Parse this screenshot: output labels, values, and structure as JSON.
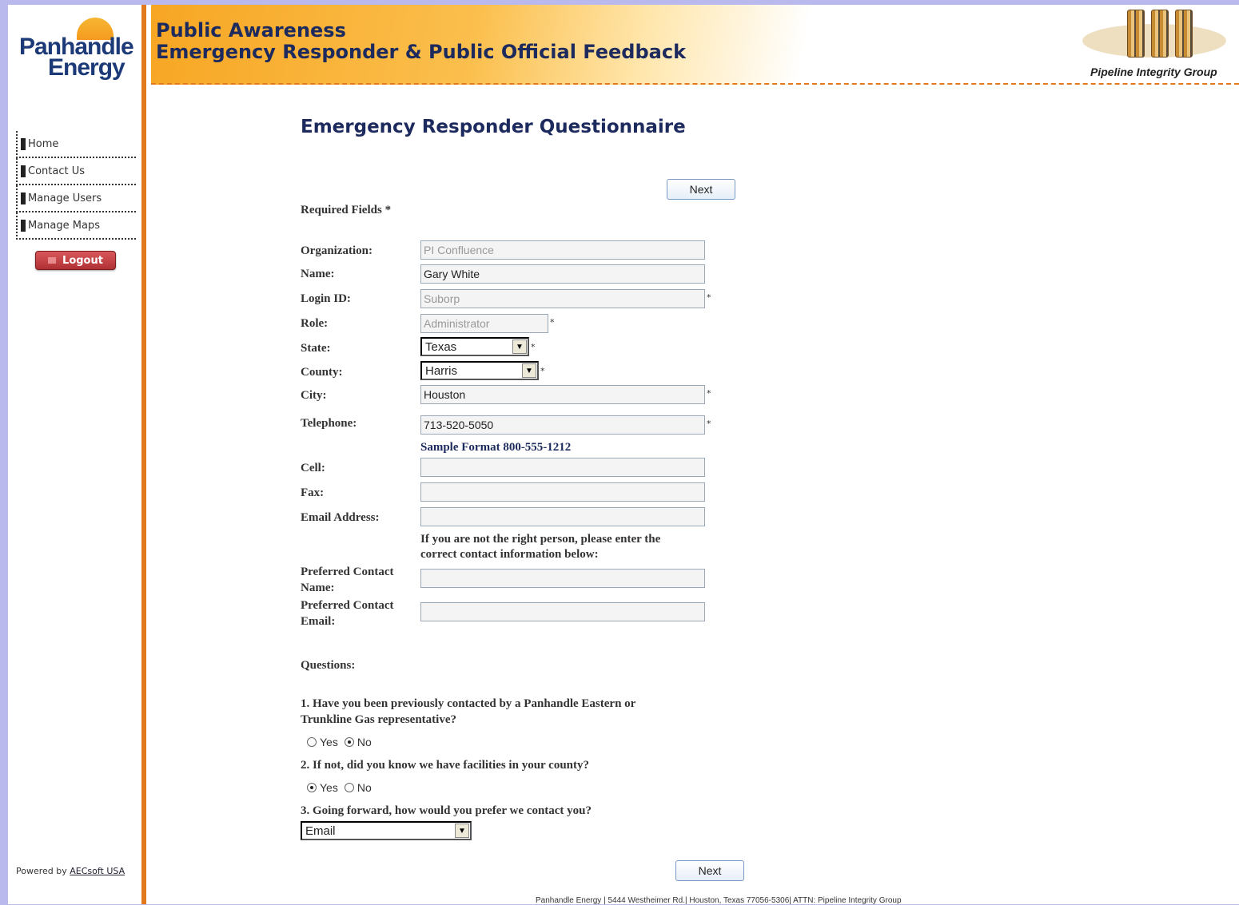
{
  "brand": {
    "line1": "Panhandle",
    "line2": "Energy"
  },
  "nav": {
    "items": [
      "Home",
      "Contact Us",
      "Manage Users",
      "Manage Maps"
    ],
    "logout": "Logout"
  },
  "powered": {
    "prefix": "Powered by ",
    "link": "AECsoft USA"
  },
  "header": {
    "title1": "Public Awareness",
    "title2": "Emergency Responder & Public Official Feedback",
    "partner": "Pipeline Integrity Group"
  },
  "page": {
    "title": "Emergency Responder Questionnaire",
    "next": "Next",
    "required": "Required Fields *"
  },
  "form": {
    "organization": {
      "label": "Organization:",
      "value": "PI Confluence"
    },
    "name": {
      "label": "Name:",
      "value": "Gary White"
    },
    "login": {
      "label": "Login ID:",
      "value": "Suborp"
    },
    "role": {
      "label": "Role:",
      "value": "Administrator"
    },
    "state": {
      "label": "State:",
      "value": "Texas"
    },
    "county": {
      "label": "County:",
      "value": "Harris"
    },
    "city": {
      "label": "City:",
      "value": "Houston"
    },
    "telephone": {
      "label": "Telephone:",
      "value": "713-520-5050",
      "hint": "Sample Format 800-555-1212"
    },
    "cell": {
      "label": "Cell:",
      "value": ""
    },
    "fax": {
      "label": "Fax:",
      "value": ""
    },
    "email": {
      "label": "Email Address:",
      "value": ""
    },
    "note1": "If you are not the right person, please enter the",
    "note2": "correct contact information below:",
    "pref_name": {
      "label1": "Preferred Contact",
      "label2": "Name:",
      "value": ""
    },
    "pref_email": {
      "label1": "Preferred Contact",
      "label2": "Email:",
      "value": ""
    },
    "req_mark": "*"
  },
  "questions": {
    "heading": "Questions:",
    "q1": {
      "line1": "1. Have you been previously contacted by a Panhandle Eastern or",
      "line2": "Trunkline Gas representative?",
      "yes": "Yes",
      "no": "No",
      "selected": "No"
    },
    "q2": {
      "text": "2. If not, did you know we have facilities in your county?",
      "yes": "Yes",
      "no": "No",
      "selected": "Yes"
    },
    "q3": {
      "text": "3. Going forward, how would you prefer we contact you?",
      "value": "Email"
    }
  },
  "footer": "Panhandle Energy  |  5444 Westheimer Rd.|  Houston, Texas 77056-5306|  ATTN: Pipeline Integrity Group",
  "colors": {
    "accent": "#e2791c",
    "title": "#1c2a5e",
    "logout": "#b03135"
  }
}
